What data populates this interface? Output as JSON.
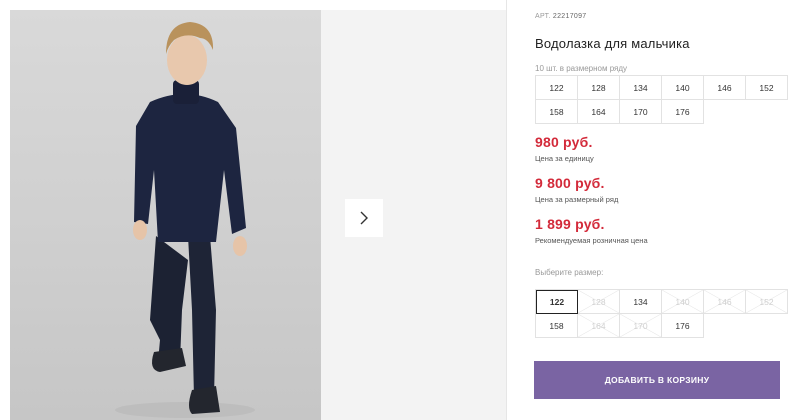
{
  "product": {
    "article_label": "АРТ.",
    "article_number": "22217097",
    "title": "Водолазка для мальчика",
    "series_note": "10 шт. в размерном ряду"
  },
  "series_sizes": [
    "122",
    "128",
    "134",
    "140",
    "146",
    "152",
    "158",
    "164",
    "170",
    "176"
  ],
  "prices": {
    "unit_price": "980 руб.",
    "unit_label": "Цена за единицу",
    "series_price": "9 800 руб.",
    "series_label": "Цена за размерный ряд",
    "retail_price": "1 899 руб.",
    "retail_label": "Рекомендуемая розничная цена"
  },
  "size_picker": {
    "label": "Выберите размер:",
    "selected": "122",
    "sizes": [
      {
        "size": "122",
        "available": true
      },
      {
        "size": "128",
        "available": false
      },
      {
        "size": "134",
        "available": true
      },
      {
        "size": "140",
        "available": false
      },
      {
        "size": "146",
        "available": false
      },
      {
        "size": "152",
        "available": false
      },
      {
        "size": "158",
        "available": true
      },
      {
        "size": "164",
        "available": false
      },
      {
        "size": "170",
        "available": false
      },
      {
        "size": "176",
        "available": true
      }
    ]
  },
  "cart": {
    "add_label": "ДОБАВИТЬ В КОРЗИНУ"
  },
  "colors": {
    "price": "#d32a3a",
    "button": "#7a64a3"
  },
  "icons": {
    "next": "chevron-right-icon"
  }
}
